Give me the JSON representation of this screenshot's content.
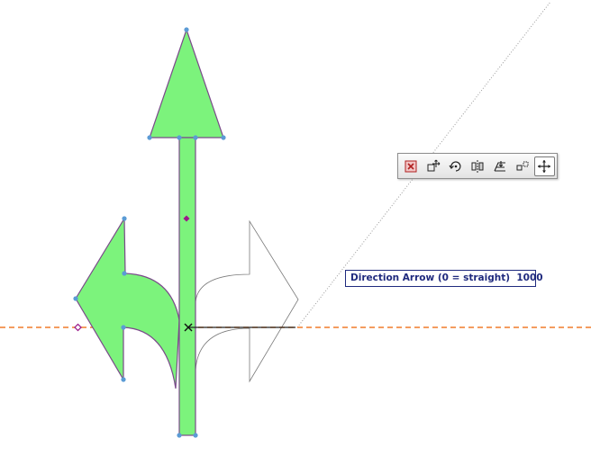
{
  "readout": {
    "label": "Direction Arrow (0 = straight)",
    "value": "1000"
  },
  "toolbar": {
    "buttons": [
      {
        "name": "close-toolbar-button",
        "icon": "close-icon",
        "active": false
      },
      {
        "name": "move-node-button",
        "icon": "move-node-icon",
        "active": false
      },
      {
        "name": "rotate-button",
        "icon": "rotate-icon",
        "active": false
      },
      {
        "name": "mirror-button",
        "icon": "mirror-icon",
        "active": false
      },
      {
        "name": "elevate-button",
        "icon": "elevate-icon",
        "active": false
      },
      {
        "name": "multiply-button",
        "icon": "multiply-icon",
        "active": false
      },
      {
        "name": "drag-button",
        "icon": "drag-icon",
        "active": true
      }
    ]
  },
  "colors": {
    "arrow_fill": "#7cf37c",
    "arrow_outline": "#7a4a8a",
    "hotspot": "#5b9bd5",
    "edit_hotspot": "#9b1a8a",
    "reference_line": "#f07b2a",
    "readout_text": "#1f2a7e"
  }
}
